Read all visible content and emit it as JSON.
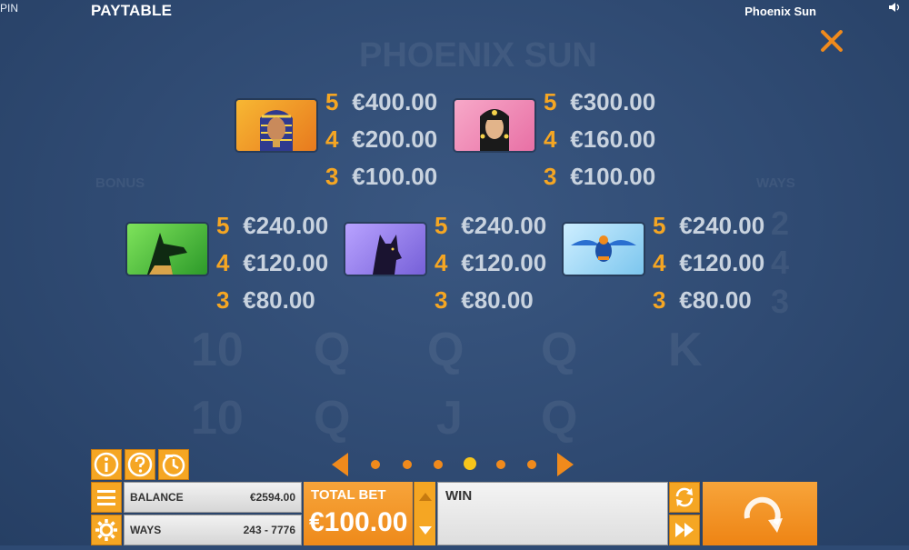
{
  "status": {
    "left_text": "PIN",
    "title": "PAYTABLE",
    "game_name": "Phoenix Sun"
  },
  "background": {
    "logo": "PHOENIX SUN",
    "bonus": "BONUS",
    "ways": "WAYS",
    "ways_digits": [
      "2",
      "4",
      "3"
    ],
    "reel_symbols": [
      "10",
      "Q",
      "Q",
      "Q",
      "K",
      "10",
      "Q",
      "J",
      "Q"
    ]
  },
  "paytable": {
    "symbols": [
      {
        "icon": "pharaoh-icon",
        "pays": [
          {
            "count": "5",
            "amount": "€400.00"
          },
          {
            "count": "4",
            "amount": "€200.00"
          },
          {
            "count": "3",
            "amount": "€100.00"
          }
        ]
      },
      {
        "icon": "cleopatra-icon",
        "pays": [
          {
            "count": "5",
            "amount": "€300.00"
          },
          {
            "count": "4",
            "amount": "€160.00"
          },
          {
            "count": "3",
            "amount": "€100.00"
          }
        ]
      },
      {
        "icon": "anubis-icon",
        "pays": [
          {
            "count": "5",
            "amount": "€240.00"
          },
          {
            "count": "4",
            "amount": "€120.00"
          },
          {
            "count": "3",
            "amount": "€80.00"
          }
        ]
      },
      {
        "icon": "bastet-cat-icon",
        "pays": [
          {
            "count": "5",
            "amount": "€240.00"
          },
          {
            "count": "4",
            "amount": "€120.00"
          },
          {
            "count": "3",
            "amount": "€80.00"
          }
        ]
      },
      {
        "icon": "scarab-icon",
        "pays": [
          {
            "count": "5",
            "amount": "€240.00"
          },
          {
            "count": "4",
            "amount": "€120.00"
          },
          {
            "count": "3",
            "amount": "€80.00"
          }
        ]
      }
    ]
  },
  "pagination": {
    "pages": 6,
    "active_page": 4
  },
  "bottom": {
    "balance_label": "BALANCE",
    "balance_value": "€2594.00",
    "ways_label": "WAYS",
    "ways_value": "243 - 7776",
    "total_bet_label": "TOTAL BET",
    "total_bet_value": "€100.00",
    "win_label": "WIN"
  },
  "colors": {
    "accent": "#f08a1c",
    "payout_count": "#f5a623",
    "payout_value": "#c9d3df",
    "background": "#2e4a73"
  }
}
